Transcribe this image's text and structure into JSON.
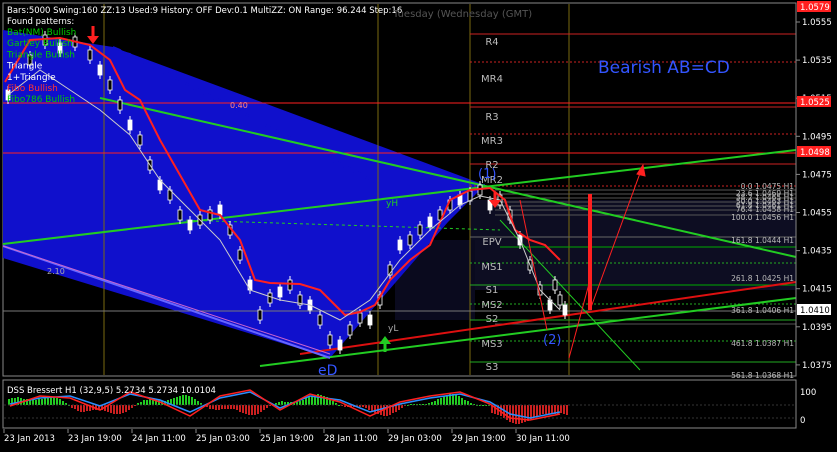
{
  "header": {
    "info_line": "Bars:5000  Swing:160  ZZ:13  Used:9  History: OFF Dev:0.1  MultiZZ: ON  Range: 96.244  Step:16",
    "found_label": "Found patterns:",
    "patterns": [
      "Bat(NM) Bullish",
      "Gartley Bullish",
      "Triangle Bullish",
      "Triangle",
      "1+Triangle",
      "Fibo Bullish",
      "Fibo786 Bullish"
    ],
    "pattern_colors": [
      "#00cc00",
      "#00cc00",
      "#00cc00",
      "#ffffff",
      "#ffffff",
      "#ff3333",
      "#00cc00"
    ],
    "ghost_label": "Tuesday  (Wednesday     (GMT)",
    "value_040": "0.40"
  },
  "chart": {
    "pattern_name": "Bearish AB=CD",
    "colors": {
      "background": "#000000",
      "pattern_fill": "#1010cc",
      "accent_text": "#3355ff",
      "pivot": "#ff2020",
      "price_tag": "#ffffff",
      "trend_line": "#22cc22"
    },
    "pivot_labels": [
      "R4",
      "MR4",
      "R3",
      "MR3",
      "R2",
      "MR2",
      "EPV",
      "MS1",
      "S1",
      "MS2",
      "S2",
      "MS3",
      "S3"
    ],
    "fib_levels": [
      "0.0 1.0475 H1",
      "23.6 1.0469 H1",
      "38.2 1.0465 H1",
      "50.0 1.0463 H1",
      "61.8 1.0461 H1",
      "76.4 1.0458 H1",
      "100.0 1.0456 H1",
      "161.8 1.0444 H1",
      "261.8 1.0425 H1",
      "361.8 1.0406 H1",
      "461.8 1.0387 H1",
      "561.8 1.0368 H1"
    ],
    "point_labels": {
      "eD": "eD",
      "one": "(1)",
      "two": "(2)",
      "yL": "yL",
      "yH": "yH",
      "left_value": "2.10"
    }
  },
  "price_axis": {
    "labels": [
      "1.0555",
      "1.0535",
      "1.0515",
      "1.0495",
      "1.0475",
      "1.0455",
      "1.0435",
      "1.0415",
      "1.0395",
      "1.0375"
    ],
    "tags": [
      {
        "text": "1.0579",
        "bg": "#ff2020",
        "fg": "#ffffff"
      },
      {
        "text": "1.0525",
        "bg": "#ff2020",
        "fg": "#ffffff"
      },
      {
        "text": "1.0498",
        "bg": "#ff2020",
        "fg": "#ffffff"
      },
      {
        "text": "1.0410",
        "bg": "#ffffff",
        "fg": "#000000"
      }
    ]
  },
  "indicator": {
    "title": "DSS Bressert H1 (32,9,5) 5.2734 5.2734 10.0104",
    "scale": [
      "100",
      "0"
    ]
  },
  "time_axis": {
    "labels": [
      "23 Jan 2013",
      "23 Jan 19:00",
      "24 Jan 11:00",
      "25 Jan 03:00",
      "25 Jan 19:00",
      "28 Jan 11:00",
      "29 Jan 03:00",
      "29 Jan 19:00",
      "30 Jan 11:00"
    ]
  }
}
